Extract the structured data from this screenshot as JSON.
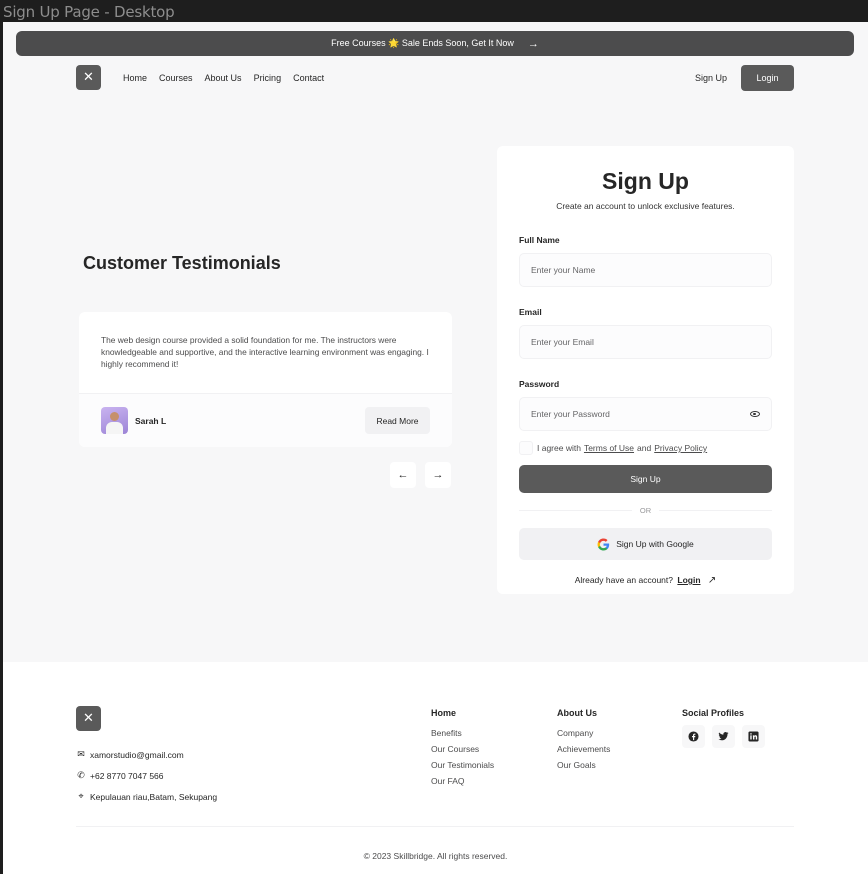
{
  "frame": {
    "title": "Sign Up Page - Desktop"
  },
  "banner": {
    "text": "Free Courses 🌟 Sale Ends Soon, Get It Now",
    "arrow": "→"
  },
  "nav": {
    "logo_icon": "skillbridge-logo-icon",
    "links": [
      "Home",
      "Courses",
      "About Us",
      "Pricing",
      "Contact"
    ],
    "signup_label": "Sign Up",
    "login_label": "Login"
  },
  "testimonials": {
    "title": "Customer Testimonials",
    "quote": "The web design course provided a solid foundation for me. The instructors were knowledgeable and supportive, and the interactive learning environment was engaging. I highly recommend it!",
    "author": "Sarah L",
    "read_more_label": "Read More",
    "prev_arrow": "←",
    "next_arrow": "→"
  },
  "signup": {
    "title": "Sign Up",
    "subtitle": "Create an account to unlock exclusive features.",
    "fullname_label": "Full Name",
    "fullname_placeholder": "Enter your Name",
    "email_label": "Email",
    "email_placeholder": "Enter your Email",
    "password_label": "Password",
    "password_placeholder": "Enter your Password",
    "agree_prefix": "I agree with",
    "terms_link": "Terms of Use",
    "agree_and": "and",
    "privacy_link": "Privacy Policy",
    "submit_label": "Sign Up",
    "or_label": "OR",
    "google_label": "Sign Up with Google",
    "have_account_text": "Already have an account?",
    "login_link": "Login",
    "login_arrow": "↗"
  },
  "footer": {
    "email": "xamorstudio@gmail.com",
    "phone": "+62 8770 7047 566",
    "address": "Kepulauan riau,Batam, Sekupang",
    "col_home": {
      "title": "Home",
      "items": [
        "Benefits",
        "Our Courses",
        "Our Testimonials",
        "Our FAQ"
      ]
    },
    "col_about": {
      "title": "About Us",
      "items": [
        "Company",
        "Achievements",
        "Our Goals"
      ]
    },
    "col_social": {
      "title": "Social Profiles",
      "icons": [
        "facebook-icon",
        "twitter-icon",
        "linkedin-icon"
      ]
    },
    "copyright": "© 2023 Skillbridge. All rights reserved."
  }
}
